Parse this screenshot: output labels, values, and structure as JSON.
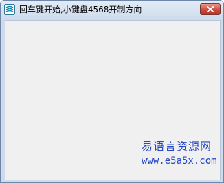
{
  "window": {
    "title": "回车键开始,小键盘4568开制方向",
    "icon": "app-icon",
    "close_icon": "close-icon"
  },
  "watermark": {
    "text": "易语言资源网",
    "url": "www.e5a5x.com"
  },
  "colors": {
    "titlebar": "#d6e2f0",
    "client_background": "#f0f0f0",
    "close_button": "#c9493a",
    "watermark": "#2447c8"
  }
}
